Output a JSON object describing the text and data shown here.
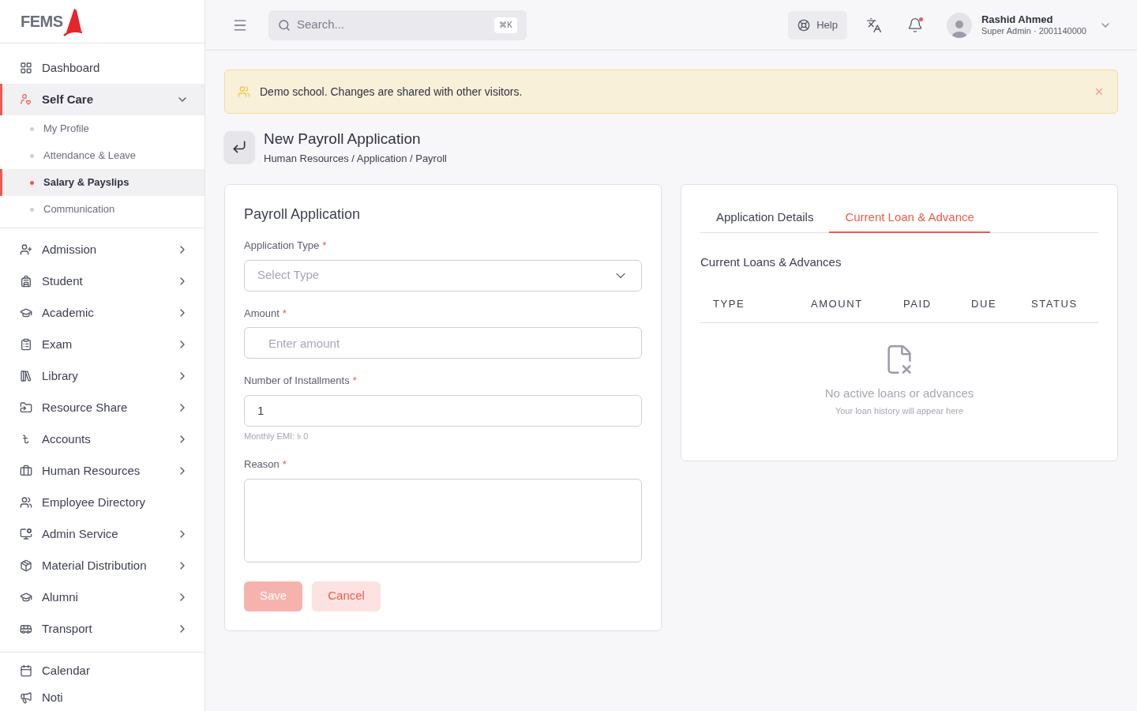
{
  "brand": {
    "logo_text": "FEMS"
  },
  "sidebar": {
    "items": [
      {
        "label": "Dashboard",
        "selected": false
      },
      {
        "label": "Self Care",
        "selected": true,
        "expanded": true,
        "children": [
          {
            "label": "My Profile",
            "selected": false
          },
          {
            "label": "Attendance & Leave",
            "selected": false
          },
          {
            "label": "Salary & Payslips",
            "selected": true
          },
          {
            "label": "Communication",
            "selected": false
          }
        ]
      },
      {
        "label": "Admission",
        "selected": false,
        "expanded": false
      },
      {
        "label": "Student",
        "selected": false,
        "expanded": false
      },
      {
        "label": "Academic",
        "selected": false,
        "expanded": false
      },
      {
        "label": "Exam",
        "selected": false,
        "expanded": false
      },
      {
        "label": "Library",
        "selected": false,
        "expanded": false
      },
      {
        "label": "Resource Share",
        "selected": false,
        "expanded": false
      },
      {
        "label": "Accounts",
        "selected": false,
        "expanded": false
      },
      {
        "label": "Human Resources",
        "selected": false,
        "expanded": false
      },
      {
        "label": "Employee Directory",
        "selected": false
      },
      {
        "label": "Admin Service",
        "selected": false,
        "expanded": false
      },
      {
        "label": "Material Distribution",
        "selected": false,
        "expanded": false
      },
      {
        "label": "Alumni",
        "selected": false,
        "expanded": false
      },
      {
        "label": "Transport",
        "selected": false,
        "expanded": false
      }
    ],
    "footer_items": [
      {
        "label": "Calendar",
        "selected": false
      },
      {
        "label": "Noti",
        "selected": false
      }
    ]
  },
  "topbar": {
    "search": {
      "placeholder": "Search...",
      "shortcut": "⌘K"
    },
    "help": "Help",
    "user": {
      "name": "Rashid Ahmed",
      "role": "Super Admin · 2001140000"
    },
    "notification_dot": true
  },
  "banner": {
    "text": "Demo school. Changes are shared with other visitors."
  },
  "page": {
    "title": "New Payroll Application",
    "breadcrumb": "Human Resources / Application / Payroll"
  },
  "form": {
    "title": "Payroll Application",
    "fields": [
      {
        "kind": "select",
        "label": "Application Type",
        "required_mark": "*",
        "placeholder": "Select Type"
      },
      {
        "kind": "input",
        "label": "Amount",
        "required_mark": "*",
        "placeholder": "Enter amount"
      },
      {
        "kind": "input",
        "label": "Number of Installments",
        "required_mark": "*",
        "value": "1",
        "hint": "Monthly EMI: ৳ 0"
      },
      {
        "kind": "textarea",
        "label": "Reason",
        "required_mark": "*"
      }
    ],
    "buttons": [
      {
        "kind": "primary",
        "label": "Save",
        "disabled": true
      },
      {
        "kind": "secondary",
        "label": "Cancel",
        "disabled": false
      }
    ]
  },
  "loans": {
    "tabs": [
      {
        "label": "Application Details",
        "selected": false
      },
      {
        "label": "Current Loan & Advance",
        "selected": true
      }
    ],
    "title": "Current Loans & Advances",
    "table": {
      "columns": [
        "TYPE",
        "AMOUNT",
        "PAID",
        "DUE",
        "STATUS"
      ]
    },
    "empty": {
      "title": "No active loans or advances",
      "subtitle": "Your loan history will appear here"
    }
  }
}
